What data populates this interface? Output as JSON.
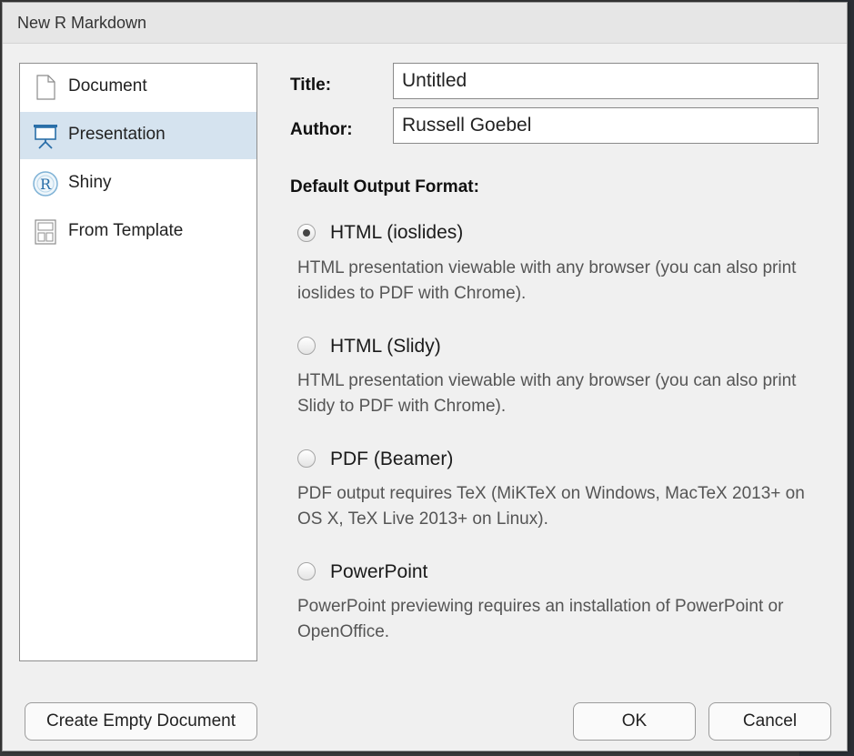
{
  "dialog": {
    "title": "New R Markdown"
  },
  "sidebar": {
    "items": [
      {
        "label": "Document",
        "icon": "document-icon",
        "selected": false
      },
      {
        "label": "Presentation",
        "icon": "presentation-icon",
        "selected": true
      },
      {
        "label": "Shiny",
        "icon": "shiny-icon",
        "selected": false
      },
      {
        "label": "From Template",
        "icon": "template-icon",
        "selected": false
      }
    ]
  },
  "form": {
    "title_label": "Title:",
    "title_value": "Untitled",
    "author_label": "Author:",
    "author_value": "Russell Goebel"
  },
  "output": {
    "heading": "Default Output Format:",
    "formats": [
      {
        "label": "HTML (ioslides)",
        "checked": true,
        "desc": "HTML presentation viewable with any browser (you can also print ioslides to PDF with Chrome)."
      },
      {
        "label": "HTML (Slidy)",
        "checked": false,
        "desc": "HTML presentation viewable with any browser (you can also print Slidy to PDF with Chrome)."
      },
      {
        "label": "PDF (Beamer)",
        "checked": false,
        "desc": "PDF output requires TeX (MiKTeX on Windows, MacTeX 2013+ on OS X, TeX Live 2013+ on Linux)."
      },
      {
        "label": "PowerPoint",
        "checked": false,
        "desc": "PowerPoint previewing requires an installation of PowerPoint or OpenOffice."
      }
    ]
  },
  "buttons": {
    "create_empty": "Create Empty Document",
    "ok": "OK",
    "cancel": "Cancel"
  },
  "colors": {
    "selected_bg": "#d5e3ef",
    "dialog_bg": "#f0f0f0",
    "icon_blue": "#2a6fa8"
  }
}
